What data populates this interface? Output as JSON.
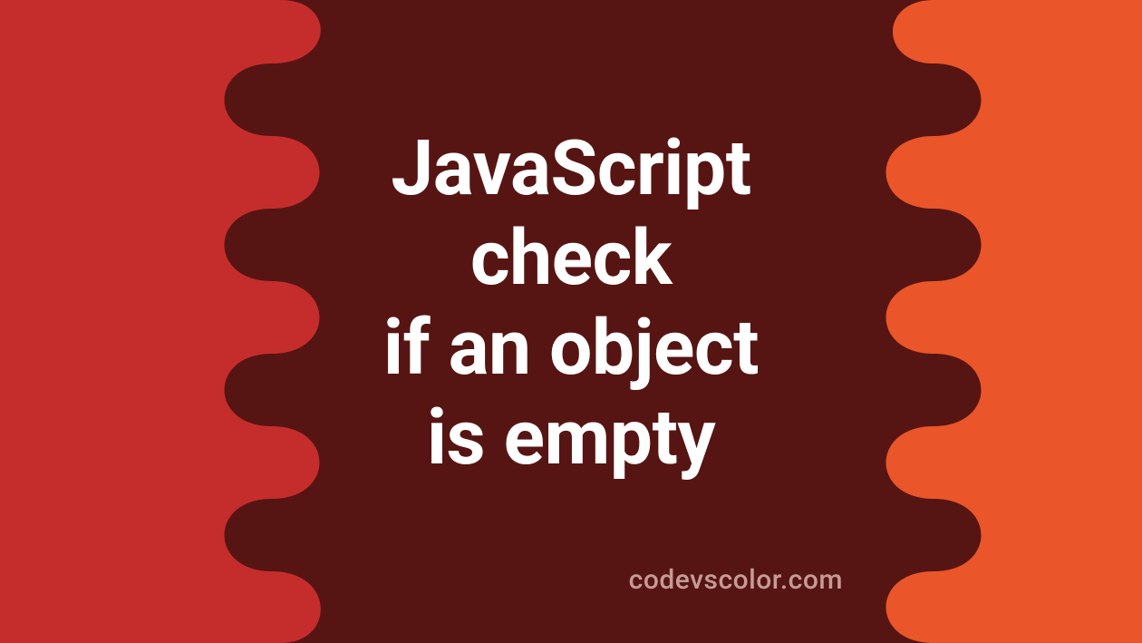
{
  "title_lines": [
    "JavaScript",
    "check",
    "if an object",
    "is empty"
  ],
  "watermark": "codevscolor.com",
  "colors": {
    "bg_dark": "#561513",
    "bg_red": "#c52d2c",
    "bg_orange": "#ea5529",
    "text": "#ffffff",
    "watermark": "#c79a95"
  }
}
